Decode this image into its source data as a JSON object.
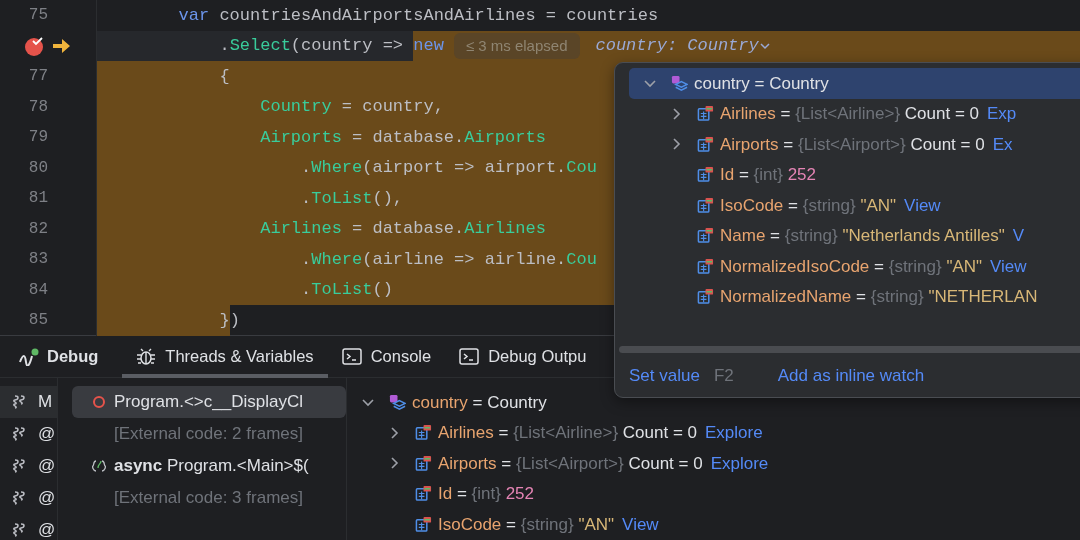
{
  "editor": {
    "lines": [
      {
        "number": "75",
        "breakpoint": false,
        "current": false,
        "tokens": [
          {
            "text": "        var",
            "kind": "keyword",
            "highlighted": false
          },
          {
            "text": " countriesAndAirportsAndAirlines = countries",
            "kind": "plain",
            "highlighted": false
          }
        ]
      },
      {
        "breakpoint": true,
        "current": true,
        "tokens": [
          {
            "text": "            .",
            "kind": "plain",
            "highlighted": false
          },
          {
            "text": "Select",
            "kind": "member",
            "highlighted": false
          },
          {
            "text": "(country => ",
            "kind": "plain",
            "highlighted": false
          },
          {
            "text": "new",
            "kind": "keyword",
            "highlighted": true
          },
          {
            "text": "≤ 3 ms elapsed",
            "kind": "hint",
            "highlighted": true
          },
          {
            "text": "country: Country",
            "kind": "inline_value",
            "highlighted": true
          }
        ]
      },
      {
        "number": "77",
        "breakpoint": false,
        "current": false,
        "tokens": [
          {
            "text": "            {",
            "kind": "plain",
            "highlighted": true
          }
        ]
      },
      {
        "number": "78",
        "breakpoint": false,
        "current": false,
        "tokens": [
          {
            "text": "                Country",
            "kind": "member",
            "highlighted": true
          },
          {
            "text": " = country,",
            "kind": "plain",
            "highlighted": true
          }
        ]
      },
      {
        "number": "79",
        "breakpoint": false,
        "current": false,
        "tokens": [
          {
            "text": "                Airports",
            "kind": "member",
            "highlighted": true
          },
          {
            "text": " = database.",
            "kind": "plain",
            "highlighted": true
          },
          {
            "text": "Airports",
            "kind": "member",
            "highlighted": true
          }
        ]
      },
      {
        "number": "80",
        "breakpoint": false,
        "current": false,
        "tokens": [
          {
            "text": "                    .",
            "kind": "plain",
            "highlighted": true
          },
          {
            "text": "Where",
            "kind": "member",
            "highlighted": true
          },
          {
            "text": "(airport => airport.",
            "kind": "plain",
            "highlighted": true
          },
          {
            "text": "Cou",
            "kind": "member",
            "highlighted": true
          }
        ]
      },
      {
        "number": "81",
        "breakpoint": false,
        "current": false,
        "tokens": [
          {
            "text": "                    .",
            "kind": "plain",
            "highlighted": true
          },
          {
            "text": "ToList",
            "kind": "member",
            "highlighted": true
          },
          {
            "text": "(),",
            "kind": "plain",
            "highlighted": true
          }
        ]
      },
      {
        "number": "82",
        "breakpoint": false,
        "current": false,
        "tokens": [
          {
            "text": "                Airlines",
            "kind": "member",
            "highlighted": true
          },
          {
            "text": " = database.",
            "kind": "plain",
            "highlighted": true
          },
          {
            "text": "Airlines",
            "kind": "member",
            "highlighted": true
          }
        ]
      },
      {
        "number": "83",
        "breakpoint": false,
        "current": false,
        "tokens": [
          {
            "text": "                    .",
            "kind": "plain",
            "highlighted": true
          },
          {
            "text": "Where",
            "kind": "member",
            "highlighted": true
          },
          {
            "text": "(airline => airline.",
            "kind": "plain",
            "highlighted": true
          },
          {
            "text": "Cou",
            "kind": "member",
            "highlighted": true
          }
        ]
      },
      {
        "number": "84",
        "breakpoint": false,
        "current": false,
        "tokens": [
          {
            "text": "                    .",
            "kind": "plain",
            "highlighted": true
          },
          {
            "text": "ToList",
            "kind": "member",
            "highlighted": true
          },
          {
            "text": "()",
            "kind": "plain",
            "highlighted": true
          }
        ]
      },
      {
        "number": "85",
        "breakpoint": false,
        "current": false,
        "tokens": [
          {
            "text": "            }",
            "kind": "plain",
            "highlighted": true
          },
          {
            "text": ")",
            "kind": "plain",
            "highlighted": false
          }
        ]
      }
    ]
  },
  "debug_panel": {
    "title": "Debug",
    "tabs": [
      {
        "label": "Threads & Variables",
        "kind": "variables",
        "selected": true
      },
      {
        "label": "Console",
        "kind": "console",
        "selected": false
      },
      {
        "label": "Debug Outpu",
        "kind": "output",
        "selected": false
      }
    ],
    "threads": [
      {
        "label": "M",
        "selected": true
      },
      {
        "label": "@",
        "selected": false
      },
      {
        "label": "@",
        "selected": false
      },
      {
        "label": "@",
        "selected": false
      },
      {
        "label": "@",
        "selected": false
      }
    ],
    "frames": [
      {
        "label": "Program.<>c__DisplayCl",
        "kind": "frame",
        "selected": true
      },
      {
        "label": "[External code: 2 frames]",
        "kind": "external",
        "selected": false
      },
      {
        "label": "**async** Program.<Main>$(",
        "kind": "async",
        "selected": false
      },
      {
        "label": "[External code: 3 frames]",
        "kind": "external",
        "selected": false
      }
    ],
    "variables": [
      {
        "name": "country",
        "operator": "=",
        "value": "Country",
        "color": "#dfe1e5",
        "kind": "object",
        "expanded": true,
        "selected": false,
        "children": [
          {
            "name": "Airlines",
            "operator": "=",
            "type": "{List<Airline>}",
            "value": "Count = 0",
            "color": "#dfe1e5",
            "link": "Explore",
            "kind": "field",
            "expanded": false,
            "selected": false
          },
          {
            "name": "Airports",
            "operator": "=",
            "type": "{List<Airport>}",
            "value": "Count = 0",
            "color": "#dfe1e5",
            "link": "Explore",
            "kind": "field",
            "expanded": false,
            "selected": false
          },
          {
            "name": "Id",
            "operator": "=",
            "type": "{int}",
            "value": "252",
            "color": "#e484b4",
            "kind": "field",
            "selected": false
          },
          {
            "name": "IsoCode",
            "operator": "=",
            "type": "{string}",
            "value": "\"AN\"",
            "color": "#d8b777",
            "link": "View",
            "kind": "field",
            "selected": false
          }
        ]
      }
    ]
  },
  "value_popup": {
    "rows": [
      {
        "name": "country",
        "operator": "=",
        "value": "Country",
        "color": "#dfe1e5",
        "kind": "object",
        "expanded": true,
        "selected": true,
        "children": [
          {
            "name": "Airlines",
            "operator": "=",
            "type": "{List<Airline>}",
            "value": "Count = 0",
            "color": "#dfe1e5",
            "link": "Exp",
            "kind": "field",
            "expanded": false,
            "selected": false
          },
          {
            "name": "Airports",
            "operator": "=",
            "type": "{List<Airport>}",
            "value": "Count = 0",
            "color": "#dfe1e5",
            "link": "Ex",
            "kind": "field",
            "expanded": false,
            "selected": false
          },
          {
            "name": "Id",
            "operator": "=",
            "type": "{int}",
            "value": "252",
            "color": "#e484b4",
            "kind": "field",
            "selected": false
          },
          {
            "name": "IsoCode",
            "operator": "=",
            "type": "{string}",
            "value": "\"AN\"",
            "color": "#d8b777",
            "link": "View",
            "kind": "field",
            "selected": false
          },
          {
            "name": "Name",
            "operator": "=",
            "type": "{string}",
            "value": "\"Netherlands Antilles\"",
            "color": "#d8b777",
            "link": "V",
            "kind": "field",
            "selected": false
          },
          {
            "name": "NormalizedIsoCode",
            "operator": "=",
            "type": "{string}",
            "value": "\"AN\"",
            "color": "#d8b777",
            "link": "View",
            "kind": "field",
            "selected": false
          },
          {
            "name": "NormalizedName",
            "operator": "=",
            "type": "{string}",
            "value": "\"NETHERLAN",
            "color": "#d8b777",
            "kind": "field",
            "selected": false
          }
        ]
      }
    ],
    "actions": [
      {
        "label": "Set value",
        "shortcut": "F2"
      },
      {
        "label": "Add as inline watch"
      }
    ]
  }
}
